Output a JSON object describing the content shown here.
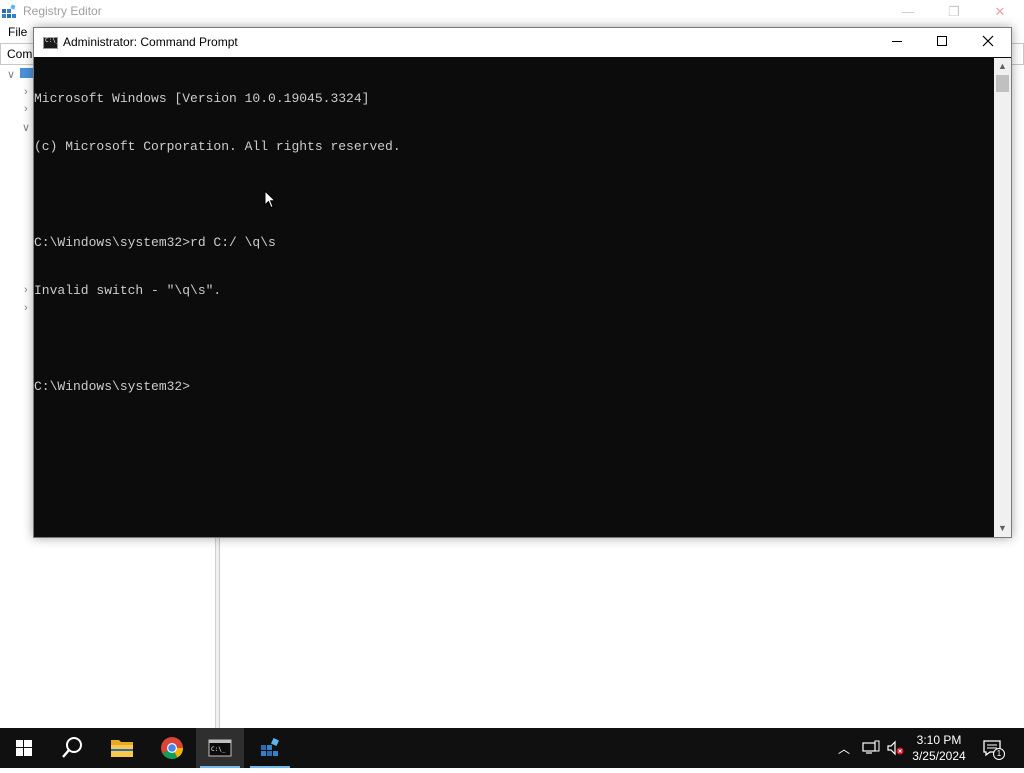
{
  "registry_editor": {
    "title": "Registry Editor",
    "menu_file": "File",
    "address_fragment": "Com"
  },
  "cmd": {
    "title": "Administrator: Command Prompt",
    "icon_text": "C:\\_",
    "lines": [
      "Microsoft Windows [Version 10.0.19045.3324]",
      "(c) Microsoft Corporation. All rights reserved.",
      "",
      "C:\\Windows\\system32>rd C:/ \\q\\s",
      "Invalid switch - \"\\q\\s\".",
      "",
      "C:\\Windows\\system32>"
    ]
  },
  "taskbar": {
    "items": [
      {
        "name": "start-button",
        "icon": "windows-logo-icon"
      },
      {
        "name": "search-button",
        "icon": "search-icon"
      },
      {
        "name": "file-explorer-button",
        "icon": "folder-icon"
      },
      {
        "name": "chrome-button",
        "icon": "chrome-icon"
      },
      {
        "name": "command-prompt-button",
        "icon": "cmd-icon",
        "active": true
      },
      {
        "name": "registry-editor-button",
        "icon": "regedit-icon"
      }
    ],
    "tray": {
      "time": "3:10 PM",
      "date": "3/25/2024",
      "notification_count": "1"
    }
  },
  "colors": {
    "console_bg": "#0c0c0c",
    "console_fg": "#cccccc",
    "taskbar_bg": "#101010",
    "active_indicator": "#76b9ed"
  }
}
